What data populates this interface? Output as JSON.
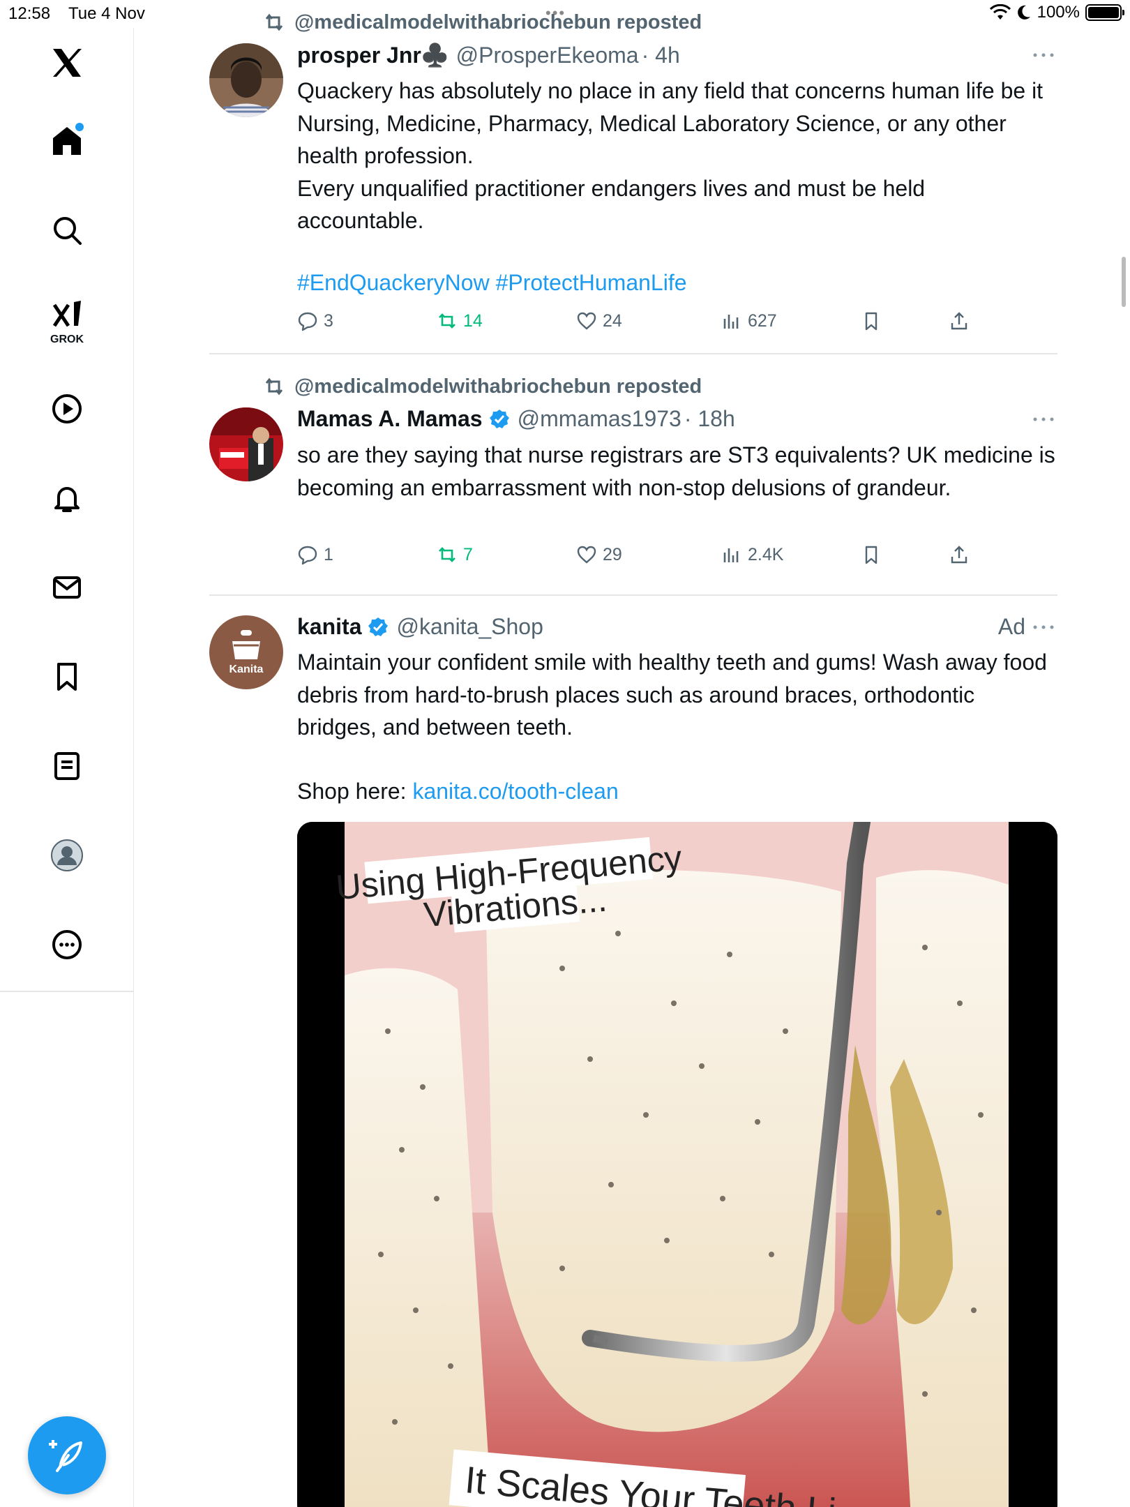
{
  "status_bar": {
    "time": "12:58",
    "date": "Tue 4 Nov",
    "battery": "100%"
  },
  "sidebar": {
    "items": [
      {
        "name": "home",
        "label": "Home"
      },
      {
        "name": "explore",
        "label": "Explore"
      },
      {
        "name": "grok",
        "label": "GROK"
      },
      {
        "name": "video",
        "label": "Video"
      },
      {
        "name": "notifications",
        "label": "Notifications"
      },
      {
        "name": "messages",
        "label": "Messages"
      },
      {
        "name": "bookmarks",
        "label": "Bookmarks"
      },
      {
        "name": "lists",
        "label": "Lists"
      },
      {
        "name": "profile",
        "label": "Profile"
      },
      {
        "name": "more",
        "label": "More"
      }
    ]
  },
  "posts": [
    {
      "repost_by": "@medicalmodelwithabriochebun reposted",
      "display_name": "prosper Jnr♣️",
      "handle": "@ProsperEkeoma",
      "time": "· 4h",
      "text": "Quackery has absolutely no place in any field that concerns human life be it Nursing, Medicine, Pharmacy, Medical Laboratory Science, or any other health profession.\nEvery unqualified practitioner endangers lives and must be held accountable.",
      "hashtags": "#EndQuackeryNow #ProtectHumanLife",
      "replies": "3",
      "reposts": "14",
      "likes": "24",
      "views": "627"
    },
    {
      "repost_by": "@medicalmodelwithabriochebun reposted",
      "display_name": "Mamas A. Mamas",
      "handle": "@mmamas1973",
      "time": "· 18h",
      "verified": true,
      "text": "so are they saying that nurse registrars are ST3 equivalents? UK medicine is becoming an embarrassment with non-stop delusions of grandeur.",
      "replies": "1",
      "reposts": "7",
      "likes": "29",
      "views": "2.4K"
    },
    {
      "display_name": "kanita",
      "handle": "@kanita_Shop",
      "verified": true,
      "ad_label": "Ad",
      "avatar_text": "Kanita",
      "text": "Maintain your confident smile with healthy teeth and gums! Wash away food debris from hard-to-brush places such as around braces, orthodontic bridges, and between teeth.",
      "shop_prefix": "Shop here: ",
      "shop_link": "kanita.co/tooth-clean",
      "media": {
        "caption_top_1": "Using High-Frequency",
        "caption_top_2": "Vibrations...",
        "caption_bottom": "It Scales Your Teeth Li"
      }
    }
  ],
  "colors": {
    "accent": "#1d9bf0",
    "retweet_green": "#00ba7c",
    "muted": "#536471"
  }
}
